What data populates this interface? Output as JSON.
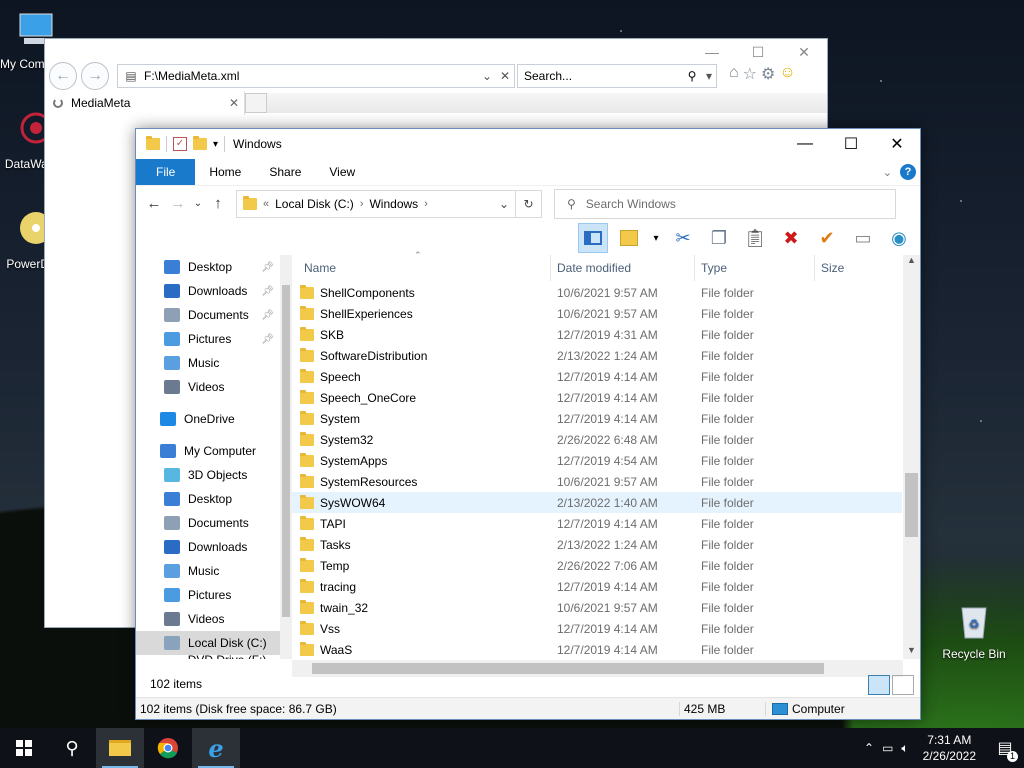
{
  "desktop": {
    "icons": [
      {
        "label": "My Computer",
        "icon": "computer-icon"
      },
      {
        "label": "DataWalker",
        "icon": "datawalker-icon"
      },
      {
        "label": "PowerDVD",
        "icon": "dvd-icon"
      },
      {
        "label": "Recycle Bin",
        "icon": "recycle-bin-icon"
      }
    ]
  },
  "ie": {
    "address": "F:\\MediaMeta.xml",
    "search_placeholder": "Search...",
    "tab_title": "MediaMeta",
    "close_tab": "✕"
  },
  "explorer": {
    "title": "Windows",
    "ribbon_tabs": [
      "File",
      "Home",
      "Share",
      "View"
    ],
    "breadcrumb": {
      "prefix": "«",
      "parts": [
        "Local Disk (C:)",
        "Windows"
      ]
    },
    "search_placeholder": "Search Windows",
    "columns": [
      "Name",
      "Date modified",
      "Type",
      "Size"
    ],
    "nav": [
      {
        "label": "Desktop",
        "color": "#3a7fd5",
        "pinned": true
      },
      {
        "label": "Downloads",
        "color": "#2a6cc4",
        "pinned": true
      },
      {
        "label": "Documents",
        "color": "#8ea0b4",
        "pinned": true
      },
      {
        "label": "Pictures",
        "color": "#4a9be0",
        "pinned": true
      },
      {
        "label": "Music",
        "color": "#5aa0e0",
        "pinned": false
      },
      {
        "label": "Videos",
        "color": "#6b7a8f",
        "pinned": false
      },
      {
        "label": "OneDrive",
        "color": "#1e88e5",
        "pinned": false,
        "top": true
      },
      {
        "label": "My Computer",
        "color": "#3a7fd5",
        "pinned": false,
        "top": true
      },
      {
        "label": "3D Objects",
        "color": "#58b7e0",
        "pinned": false
      },
      {
        "label": "Desktop",
        "color": "#3a7fd5",
        "pinned": false
      },
      {
        "label": "Documents",
        "color": "#8ea0b4",
        "pinned": false
      },
      {
        "label": "Downloads",
        "color": "#2a6cc4",
        "pinned": false
      },
      {
        "label": "Music",
        "color": "#5aa0e0",
        "pinned": false
      },
      {
        "label": "Pictures",
        "color": "#4a9be0",
        "pinned": false
      },
      {
        "label": "Videos",
        "color": "#6b7a8f",
        "pinned": false
      },
      {
        "label": "Local Disk (C:)",
        "color": "#8aa3bd",
        "pinned": false,
        "selected": true
      },
      {
        "label": "DVD Drive (F:) D\\",
        "color": "#9a9a9a",
        "pinned": false
      }
    ],
    "files": [
      {
        "name": "ShellComponents",
        "date": "10/6/2021 9:57 AM",
        "type": "File folder"
      },
      {
        "name": "ShellExperiences",
        "date": "10/6/2021 9:57 AM",
        "type": "File folder"
      },
      {
        "name": "SKB",
        "date": "12/7/2019 4:31 AM",
        "type": "File folder"
      },
      {
        "name": "SoftwareDistribution",
        "date": "2/13/2022 1:24 AM",
        "type": "File folder"
      },
      {
        "name": "Speech",
        "date": "12/7/2019 4:14 AM",
        "type": "File folder"
      },
      {
        "name": "Speech_OneCore",
        "date": "12/7/2019 4:14 AM",
        "type": "File folder"
      },
      {
        "name": "System",
        "date": "12/7/2019 4:14 AM",
        "type": "File folder"
      },
      {
        "name": "System32",
        "date": "2/26/2022 6:48 AM",
        "type": "File folder"
      },
      {
        "name": "SystemApps",
        "date": "12/7/2019 4:54 AM",
        "type": "File folder"
      },
      {
        "name": "SystemResources",
        "date": "10/6/2021 9:57 AM",
        "type": "File folder"
      },
      {
        "name": "SysWOW64",
        "date": "2/13/2022 1:40 AM",
        "type": "File folder",
        "highlight": true
      },
      {
        "name": "TAPI",
        "date": "12/7/2019 4:14 AM",
        "type": "File folder"
      },
      {
        "name": "Tasks",
        "date": "2/13/2022 1:24 AM",
        "type": "File folder"
      },
      {
        "name": "Temp",
        "date": "2/26/2022 7:06 AM",
        "type": "File folder"
      },
      {
        "name": "tracing",
        "date": "12/7/2019 4:14 AM",
        "type": "File folder"
      },
      {
        "name": "twain_32",
        "date": "10/6/2021 9:57 AM",
        "type": "File folder"
      },
      {
        "name": "Vss",
        "date": "12/7/2019 4:14 AM",
        "type": "File folder"
      },
      {
        "name": "WaaS",
        "date": "12/7/2019 4:14 AM",
        "type": "File folder"
      }
    ],
    "item_count": "102 items",
    "status": {
      "left": "102 items (Disk free space: 86.7 GB)",
      "size": "425 MB",
      "location": "Computer"
    }
  },
  "taskbar": {
    "time": "7:31 AM",
    "date": "2/26/2022",
    "notification_count": "1"
  }
}
